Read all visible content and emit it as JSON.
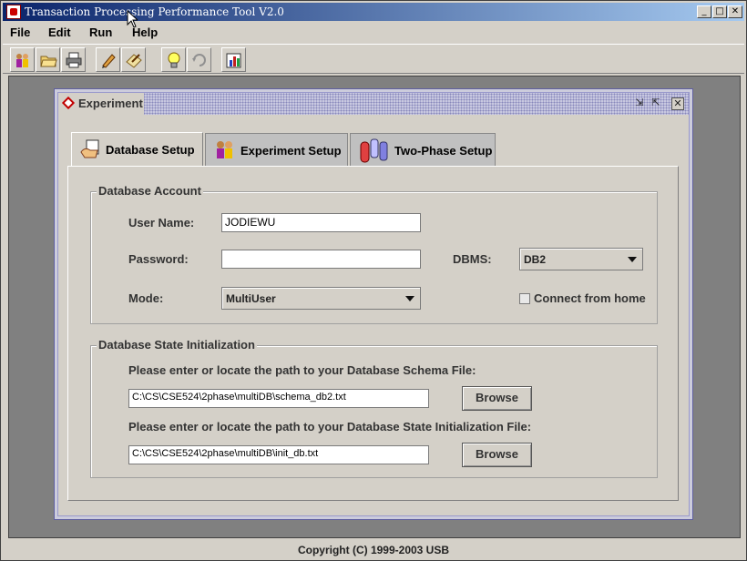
{
  "window": {
    "title": "Transaction Processing Performance Tool V2.0",
    "minimize": "_",
    "maximize": "□",
    "close": "✕"
  },
  "menu": {
    "items": [
      {
        "label": "File"
      },
      {
        "label": "Edit"
      },
      {
        "label": "Run"
      },
      {
        "label": "Help"
      }
    ]
  },
  "toolbar": {
    "buttons": [
      "users-icon",
      "open-folder-icon",
      "print-icon",
      "pencil-icon",
      "edit-document-icon",
      "lightbulb-icon",
      "refresh-icon",
      "chart-search-icon"
    ]
  },
  "experiment_frame": {
    "title": "Experiment",
    "tabs": [
      {
        "label": "Database Setup",
        "icon": "database-hand-icon",
        "active": true
      },
      {
        "label": "Experiment Setup",
        "icon": "users-icon",
        "active": false
      },
      {
        "label": "Two-Phase Setup",
        "icon": "cylinders-icon",
        "active": false
      }
    ]
  },
  "database_account": {
    "title": "Database Account",
    "username_label": "User Name:",
    "username_value": "JODIEWU",
    "password_label": "Password:",
    "password_value": "",
    "dbms_label": "DBMS:",
    "dbms_value": "DB2",
    "mode_label": "Mode:",
    "mode_value": "MultiUser",
    "connect_home_label": "Connect from home",
    "connect_home_checked": false
  },
  "db_state_init": {
    "title": "Database State Initialization",
    "schema_prompt": "Please enter or locate the path to your Database Schema File:",
    "schema_path": "C:\\CS\\CSE524\\2phase\\multiDB\\schema_db2.txt",
    "init_prompt": "Please enter or locate the path to your Database State Initialization File:",
    "init_path": "C:\\CS\\CSE524\\2phase\\multiDB\\init_db.txt",
    "browse_label": "Browse"
  },
  "status": {
    "copyright": "Copyright (C) 1999-2003 USB"
  }
}
